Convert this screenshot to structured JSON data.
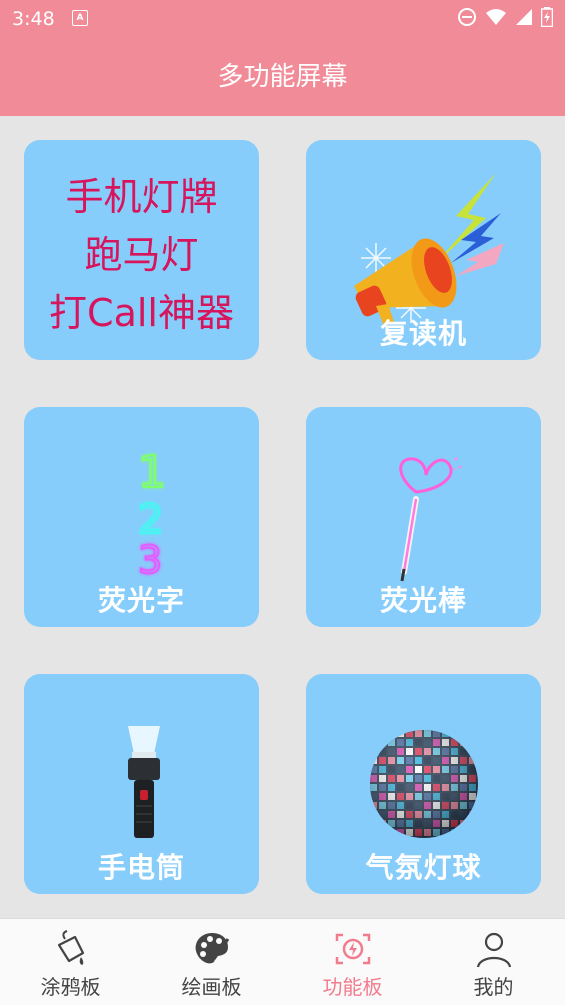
{
  "status": {
    "time": "3:48",
    "a_icon_text": "A"
  },
  "header": {
    "title": "多功能屏幕"
  },
  "cards": {
    "promo": {
      "lines": [
        "手机灯牌",
        "跑马灯",
        "打Call神器"
      ]
    },
    "repeater": {
      "label": "复读机"
    },
    "glow_text": {
      "label": "荧光字",
      "digits": [
        "1",
        "2",
        "3"
      ]
    },
    "glow_stick": {
      "label": "荧光棒"
    },
    "flashlight": {
      "label": "手电筒"
    },
    "disco_ball": {
      "label": "气氛灯球"
    }
  },
  "nav": {
    "items": [
      {
        "label": "涂鸦板",
        "icon": "paint-bucket-icon"
      },
      {
        "label": "绘画板",
        "icon": "palette-icon"
      },
      {
        "label": "功能板",
        "icon": "function-panel-icon",
        "active": true
      },
      {
        "label": "我的",
        "icon": "user-icon"
      }
    ]
  },
  "colors": {
    "accent": "#f28b98",
    "card": "#87cdfb",
    "promo_text": "#d6155d",
    "active_nav": "#f27c8e"
  }
}
